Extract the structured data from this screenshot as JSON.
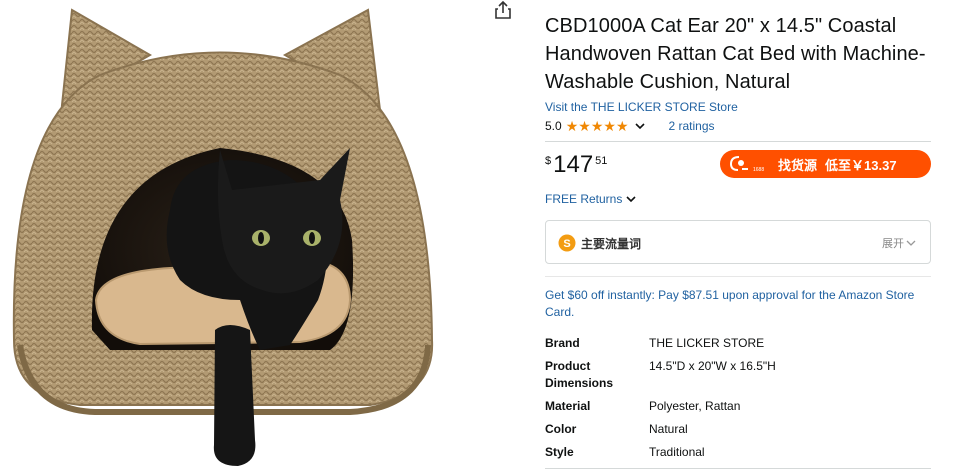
{
  "product": {
    "title": "CBD1000A Cat Ear 20\" x 14.5\" Coastal Handwoven Rattan Cat Bed with Machine-Washable Cushion, Natural",
    "store_link": "Visit the THE LICKER STORE Store",
    "rating": "5.0",
    "stars": 5,
    "ratings_count": "2 ratings",
    "image_icon": "rattan-cat-bed-with-black-cat-image"
  },
  "price": {
    "symbol": "$",
    "whole": "147",
    "fraction": "51"
  },
  "source_button": {
    "logo_text": "1688",
    "label": "找货源",
    "sub": "低至￥13.37",
    "color": "#ff5000"
  },
  "returns": {
    "label": "FREE Returns"
  },
  "keywords": {
    "label": "主要流量词",
    "expand": "展开"
  },
  "promo": "Get $60 off instantly: Pay $87.51 upon approval for the Amazon Store Card.",
  "details": [
    {
      "key": "Brand",
      "value": "THE LICKER STORE"
    },
    {
      "key": "Product Dimensions",
      "value": "14.5\"D x 20\"W x 16.5\"H"
    },
    {
      "key": "Material",
      "value": "Polyester, Rattan"
    },
    {
      "key": "Color",
      "value": "Natural"
    },
    {
      "key": "Style",
      "value": "Traditional"
    }
  ],
  "colors": {
    "link": "#2162a1",
    "star": "#f08804",
    "accent": "#ff5000"
  }
}
